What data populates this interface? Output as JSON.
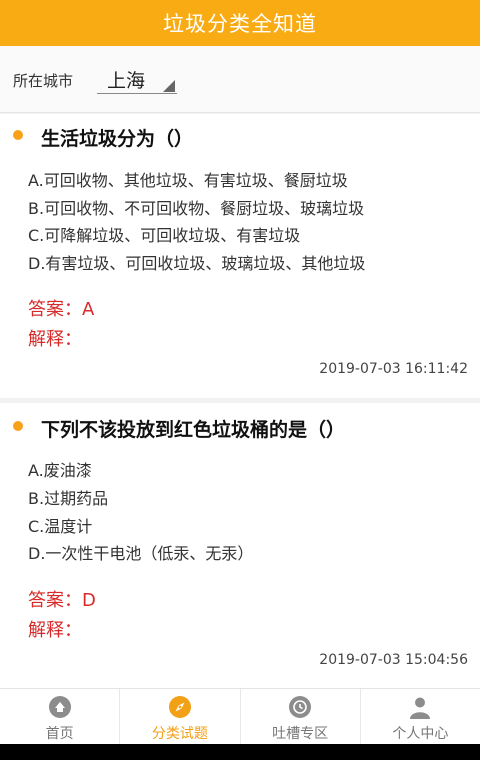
{
  "app": {
    "title": "垃圾分类全知道"
  },
  "city": {
    "label": "所在城市",
    "selected": "上海"
  },
  "questions": [
    {
      "title": "生活垃圾分为（）",
      "options": [
        "A.可回收物、其他垃圾、有害垃圾、餐厨垃圾",
        "B.可回收物、不可回收物、餐厨垃圾、玻璃垃圾",
        "C.可降解垃圾、可回收垃圾、有害垃圾",
        "D.有害垃圾、可回收垃圾、玻璃垃圾、其他垃圾"
      ],
      "answer_label": "答案：",
      "answer": "A",
      "explain_label": "解释：",
      "explain": "",
      "timestamp": "2019-07-03 16:11:42"
    },
    {
      "title": "下列不该投放到红色垃圾桶的是（）",
      "options": [
        "A.废油漆",
        "B.过期药品",
        "C.温度计",
        "D.一次性干电池（低汞、无汞）"
      ],
      "answer_label": "答案：",
      "answer": "D",
      "explain_label": "解释：",
      "explain": "",
      "timestamp": "2019-07-03 15:04:56"
    }
  ],
  "tabs": [
    {
      "label": "首页",
      "icon": "home-icon",
      "active": false
    },
    {
      "label": "分类试题",
      "icon": "compass-icon",
      "active": true
    },
    {
      "label": "吐槽专区",
      "icon": "history-icon",
      "active": false
    },
    {
      "label": "个人中心",
      "icon": "person-icon",
      "active": false
    }
  ],
  "colors": {
    "accent": "#f9ab14",
    "answer": "#d82a2a",
    "active_tab": "#f2a015",
    "inactive_icon": "#8c8c8c"
  }
}
